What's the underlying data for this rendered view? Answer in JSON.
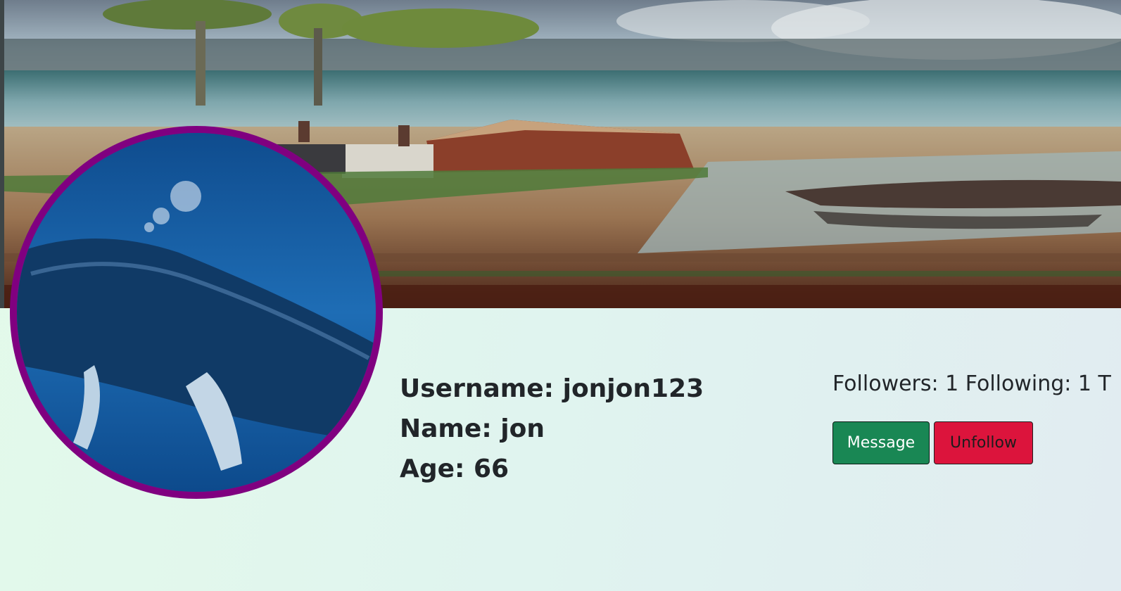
{
  "profile": {
    "username_line": "Username: jonjon123",
    "name_line": "Name: jon",
    "age_line": "Age: 66"
  },
  "stats": {
    "text": "Followers: 1 Following: 1 T"
  },
  "actions": {
    "message_label": "Message",
    "unfollow_label": "Unfollow"
  },
  "colors": {
    "avatar_border": "#800080",
    "message_button": "#198754",
    "unfollow_button": "#dc143c"
  },
  "images": {
    "cover": "seaside-painting-cover",
    "avatar": "whale-underwater-avatar"
  }
}
